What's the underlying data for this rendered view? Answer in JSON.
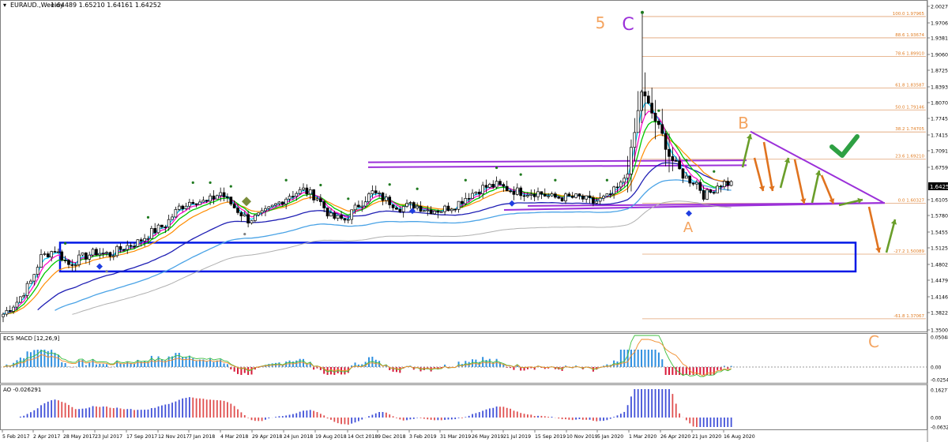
{
  "header": {
    "symbol_label": "EURAUD.,Weekly",
    "ohlc": "1.64489 1.65210 1.64161 1.64252"
  },
  "colors": {
    "bull": "#000000",
    "bear": "#000000",
    "ema_fast": "#00c8ff",
    "ema_mid": "#ff00c8",
    "ema_slow": "#00c800",
    "ema_orange": "#ff8c00",
    "ma_long1": "#1f1fb4",
    "ma_long2": "#4aa3e6",
    "ma_long3": "#b0b0b0",
    "purple": "#9b30d9",
    "blue_box": "#0018e6",
    "wave_orange": "#f4a460",
    "arrow_green": "#6a9e2a",
    "arrow_orange": "#e0731f",
    "check_green": "#2ea043",
    "fib_line": "#e0a070",
    "fib_text": "#e07b20",
    "macd_pos": "#2e8fe0",
    "macd_neg": "#d81b3b",
    "ao_up": "#4050d8",
    "ao_down": "#e05050"
  },
  "chart_data": {
    "type": "candlestick",
    "title": "EURAUD.,Weekly",
    "ylim": [
      1.345,
      2.005
    ],
    "price_ticks": [
      "2.00270",
      "1.97060",
      "1.93810",
      "1.90600",
      "1.87250",
      "1.83930",
      "1.80700",
      "1.77450",
      "1.74150",
      "1.70910",
      "1.67590",
      "1.64252",
      "1.61050",
      "1.57800",
      "1.54550",
      "1.51250",
      "1.48020",
      "1.44790",
      "1.41465",
      "1.38220",
      "1.35005"
    ],
    "current_price": "1.64252",
    "x_labels": [
      "5 Feb 2017",
      "2 Apr 2017",
      "28 May 2017",
      "23 Jul 2017",
      "17 Sep 2017",
      "12 Nov 2017",
      "7 Jan 2018",
      "4 Mar 2018",
      "29 Apr 2018",
      "24 Jun 2018",
      "19 Aug 2018",
      "14 Oct 2018",
      "9 Dec 2018",
      "3 Feb 2019",
      "31 Mar 2019",
      "26 May 2019",
      "21 Jul 2019",
      "15 Sep 2019",
      "10 Nov 2019",
      "5 Jan 2020",
      "1 Mar 2020",
      "26 Apr 2020",
      "21 Jun 2020",
      "16 Aug 2020"
    ],
    "price_path": [
      [
        0,
        1.38
      ],
      [
        4,
        1.405
      ],
      [
        8,
        1.445
      ],
      [
        11,
        1.495
      ],
      [
        15,
        1.51
      ],
      [
        19,
        1.48
      ],
      [
        23,
        1.495
      ],
      [
        27,
        1.505
      ],
      [
        31,
        1.5
      ],
      [
        35,
        1.515
      ],
      [
        39,
        1.525
      ],
      [
        43,
        1.545
      ],
      [
        47,
        1.56
      ],
      [
        51,
        1.595
      ],
      [
        55,
        1.61
      ],
      [
        59,
        1.605
      ],
      [
        63,
        1.625
      ],
      [
        67,
        1.595
      ],
      [
        71,
        1.57
      ],
      [
        75,
        1.58
      ],
      [
        79,
        1.6
      ],
      [
        83,
        1.62
      ],
      [
        87,
        1.63
      ],
      [
        91,
        1.615
      ],
      [
        95,
        1.575
      ],
      [
        99,
        1.57
      ],
      [
        103,
        1.6
      ],
      [
        107,
        1.625
      ],
      [
        111,
        1.61
      ],
      [
        115,
        1.595
      ],
      [
        119,
        1.6
      ],
      [
        123,
        1.59
      ],
      [
        127,
        1.59
      ],
      [
        131,
        1.6
      ],
      [
        135,
        1.62
      ],
      [
        139,
        1.635
      ],
      [
        143,
        1.64
      ],
      [
        147,
        1.63
      ],
      [
        151,
        1.625
      ],
      [
        155,
        1.625
      ],
      [
        159,
        1.615
      ],
      [
        163,
        1.615
      ],
      [
        167,
        1.615
      ],
      [
        171,
        1.605
      ],
      [
        175,
        1.615
      ],
      [
        179,
        1.64
      ],
      [
        181,
        1.67
      ],
      [
        183,
        1.745
      ],
      [
        185,
        1.83
      ],
      [
        187,
        1.8
      ],
      [
        189,
        1.77
      ],
      [
        191,
        1.74
      ],
      [
        193,
        1.7
      ],
      [
        195,
        1.68
      ],
      [
        197,
        1.66
      ],
      [
        199,
        1.65
      ],
      [
        201,
        1.645
      ],
      [
        203,
        1.62
      ],
      [
        205,
        1.625
      ],
      [
        207,
        1.64
      ],
      [
        209,
        1.645
      ],
      [
        211,
        1.643
      ]
    ],
    "fibonacci": [
      {
        "label": "100.0 1.97965",
        "value": 1.97965
      },
      {
        "label": "88.6 1.93674",
        "value": 1.93674
      },
      {
        "label": "78.6 1.89910",
        "value": 1.8991
      },
      {
        "label": "61.8 1.83587",
        "value": 1.83587
      },
      {
        "label": "50.0 1.79146",
        "value": 1.79146
      },
      {
        "label": "38.2 1.74705",
        "value": 1.74705
      },
      {
        "label": "23.6 1.69210",
        "value": 1.6921
      },
      {
        "label": "0.0 1.60327",
        "value": 1.60327
      },
      {
        "label": "-27.2 1.50089",
        "value": 1.50089
      },
      {
        "label": "-61.8 1.37067",
        "value": 1.37067
      }
    ],
    "wave_labels": [
      {
        "text": "5",
        "color": "orange"
      },
      {
        "text": "C",
        "color": "purple"
      },
      {
        "text": "B",
        "color": "orange"
      },
      {
        "text": "A",
        "color": "orange"
      },
      {
        "text": "C",
        "color": "orange"
      }
    ],
    "macd": {
      "label": "ECS MACD [12,26,9]",
      "ticks": [
        "0.0504880",
        "0.00",
        "-0.025493"
      ]
    },
    "ao": {
      "label": "AO -0.026291",
      "ticks": [
        "0.162774",
        "0.00",
        "-0.063213"
      ]
    }
  }
}
